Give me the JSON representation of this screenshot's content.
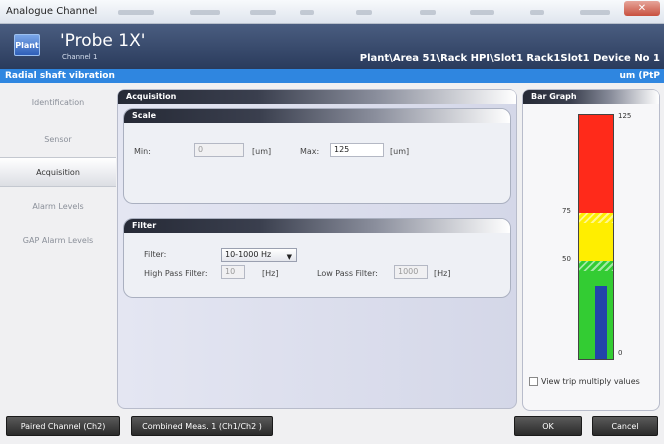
{
  "window": {
    "title": "Analogue Channel",
    "close_glyph": "✕"
  },
  "header": {
    "logo_text": "Plant",
    "probe_name": "'Probe 1X'",
    "channel_label": "Channel 1",
    "path": "Plant\\Area 51\\Rack HPI\\Slot1 Rack1Slot1 Device No 1"
  },
  "strip": {
    "left": "Radial shaft vibration",
    "right": "um (PtP"
  },
  "nav": {
    "items": [
      {
        "label": "Identification",
        "active": false
      },
      {
        "label": "Sensor",
        "active": false
      },
      {
        "label": "Acquisition",
        "active": true
      },
      {
        "label": "Alarm Levels",
        "active": false
      },
      {
        "label": "GAP Alarm Levels",
        "active": false
      }
    ]
  },
  "acquisition": {
    "title": "Acquisition",
    "scale": {
      "title": "Scale",
      "min_label": "Min:",
      "min_value": "0",
      "min_unit": "[um]",
      "max_label": "Max:",
      "max_value": "125",
      "max_unit": "[um]"
    },
    "filter": {
      "title": "Filter",
      "filter_label": "Filter:",
      "filter_value": "10-1000 Hz",
      "hp_label": "High Pass Filter:",
      "hp_value": "10",
      "hp_unit": "[Hz]",
      "lp_label": "Low Pass Filter:",
      "lp_value": "1000",
      "lp_unit": "[Hz]"
    }
  },
  "bar_graph": {
    "title": "Bar Graph",
    "scale_max": 125,
    "ticks": [
      125,
      75,
      50,
      0
    ],
    "danger_from": 75,
    "alert_from": 50,
    "danger_color": "#ff2a1a",
    "alert_color": "#ffee00",
    "normal_color": "#33cc33",
    "bar_color": "#2244aa",
    "bar_value_fraction": 0.3,
    "trip_label": "View trip multiply values",
    "trip_checked": false
  },
  "bottom": {
    "paired_label": "Paired Channel (Ch2)",
    "combined_label": "Combined Meas. 1 (Ch1/Ch2 )",
    "ok_label": "OK",
    "cancel_label": "Cancel"
  }
}
